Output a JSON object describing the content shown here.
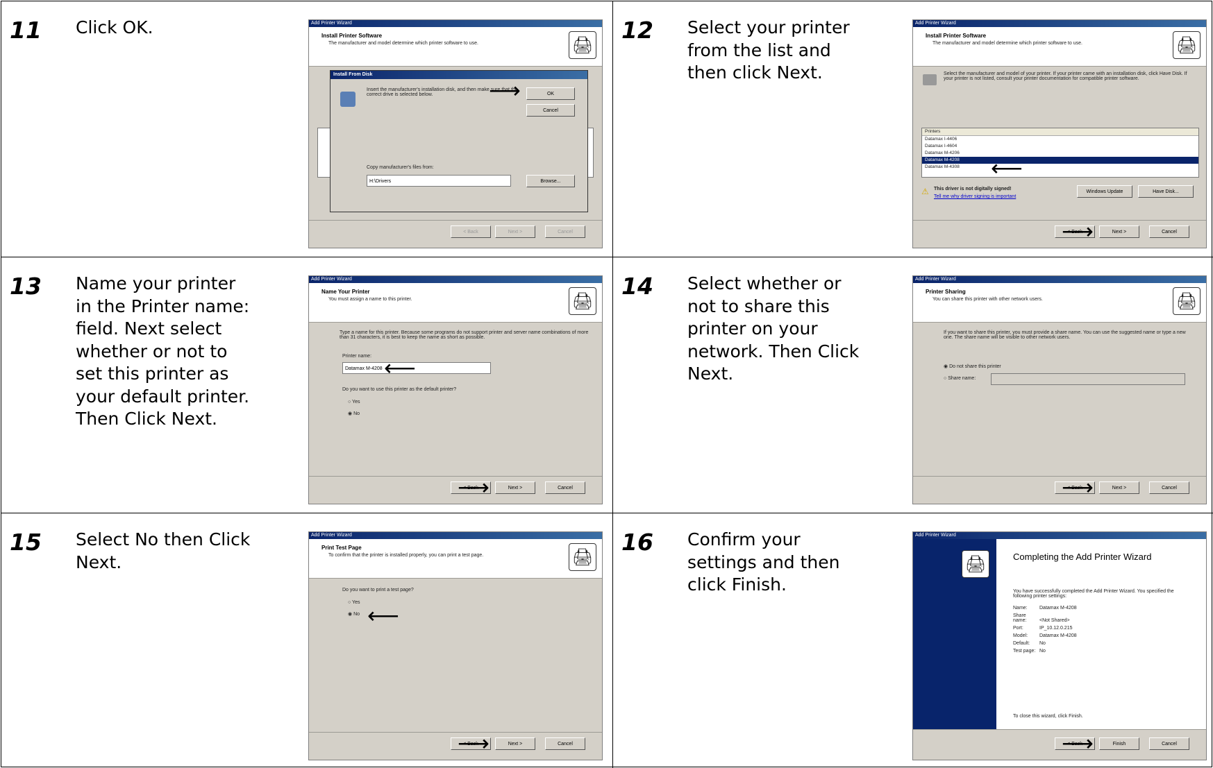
{
  "steps": [
    {
      "number": "11",
      "text": "Click OK."
    },
    {
      "number": "12",
      "text": "Select your printer from the list and then click Next."
    },
    {
      "number": "13",
      "text": "Name your printer in the Printer name: field.  Next select whether or not to set this printer as your default printer. Then Click Next."
    },
    {
      "number": "14",
      "text": "Select whether or not to share this printer on your network. Then Click Next."
    },
    {
      "number": "15",
      "text": "Select No then Click Next."
    },
    {
      "number": "16",
      "text": "Confirm your settings and then click Finish."
    }
  ],
  "shots": {
    "s11": {
      "title": "Add Printer Wizard",
      "header_title": "Install Printer Software",
      "header_sub": "The manufacturer and model determine which printer software to use.",
      "dialog_title": "Install From Disk",
      "dialog_msg": "Insert the manufacturer's installation disk, and then make sure that the correct drive is selected below.",
      "ok": "OK",
      "cancel": "Cancel",
      "copy_label": "Copy manufacturer's files from:",
      "path": "H:\\Drivers",
      "browse": "Browse...",
      "back": "< Back",
      "next": "Next >",
      "cancel2": "Cancel"
    },
    "s12": {
      "title": "Add Printer Wizard",
      "header_title": "Install Printer Software",
      "header_sub": "The manufacturer and model determine which printer software to use.",
      "instructions": "Select the manufacturer and model of your printer. If your printer came with an installation disk, click Have Disk. If your printer is not listed, consult your printer documentation for compatible printer software.",
      "list_header": "Printers",
      "items": [
        "Datamax I-4406",
        "Datamax I-4604",
        "Datamax M-4206",
        "Datamax M-4208",
        "Datamax M-4308"
      ],
      "selected_index": 3,
      "unsigned": "This driver is not digitally signed!",
      "unsigned_link": "Tell me why driver signing is important",
      "windows_update": "Windows Update",
      "have_disk": "Have Disk...",
      "back": "< Back",
      "next": "Next >",
      "cancel": "Cancel"
    },
    "s13": {
      "title": "Add Printer Wizard",
      "header_title": "Name Your Printer",
      "header_sub": "You must assign a name to this printer.",
      "body": "Type a name for this printer. Because some programs do not support printer and server name combinations of more than 31 characters, it is best to keep the name as short as possible.",
      "name_label": "Printer name:",
      "name_value": "Datamax M-4208",
      "default_q": "Do you want to use this printer as the default printer?",
      "yes": "Yes",
      "no": "No",
      "back": "< Back",
      "next": "Next >",
      "cancel": "Cancel"
    },
    "s14": {
      "title": "Add Printer Wizard",
      "header_title": "Printer Sharing",
      "header_sub": "You can share this printer with other network users.",
      "body": "If you want to share this printer, you must provide a share name. You can use the suggested name or type a new one. The share name will be visible to other network users.",
      "opt1": "Do not share this printer",
      "opt2": "Share name:",
      "back": "< Back",
      "next": "Next >",
      "cancel": "Cancel"
    },
    "s15": {
      "title": "Add Printer Wizard",
      "header_title": "Print Test Page",
      "header_sub": "To confirm that the printer is installed properly, you can print a test page.",
      "question": "Do you want to print a test page?",
      "yes": "Yes",
      "no": "No",
      "back": "< Back",
      "next": "Next >",
      "cancel": "Cancel"
    },
    "s16": {
      "title": "Add Printer Wizard",
      "heading": "Completing the Add Printer Wizard",
      "intro": "You have successfully completed the Add Printer Wizard. You specified the following printer settings:",
      "settings": [
        {
          "k": "Name:",
          "v": "Datamax M-4208"
        },
        {
          "k": "Share name:",
          "v": "<Not Shared>"
        },
        {
          "k": "Port:",
          "v": "IP_10.12.0.215"
        },
        {
          "k": "Model:",
          "v": "Datamax M-4208"
        },
        {
          "k": "Default:",
          "v": "No"
        },
        {
          "k": "Test page:",
          "v": "No"
        }
      ],
      "close": "To close this wizard, click Finish.",
      "back": "< Back",
      "finish": "Finish",
      "cancel": "Cancel"
    }
  }
}
